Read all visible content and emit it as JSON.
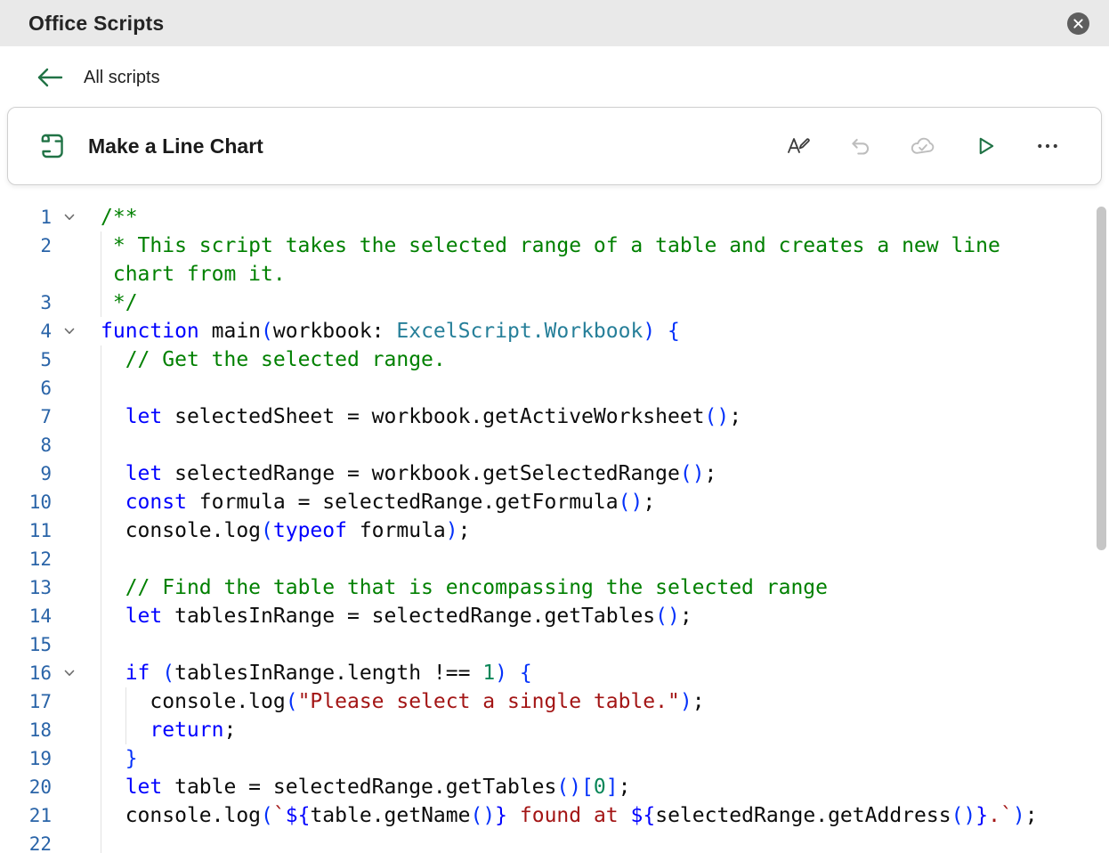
{
  "header": {
    "title": "Office Scripts"
  },
  "nav": {
    "back_label": "All scripts"
  },
  "card": {
    "title": "Make a Line Chart",
    "toolbar": [
      {
        "icon": "rename-icon",
        "enabled": true
      },
      {
        "icon": "undo-icon",
        "enabled": false
      },
      {
        "icon": "cloud-saved-icon",
        "enabled": false
      },
      {
        "icon": "run-icon",
        "enabled": true
      },
      {
        "icon": "ellipsis-icon",
        "enabled": true
      }
    ]
  },
  "colors": {
    "accent_green": "#217346",
    "close_bg": "#5e5e5e",
    "icon_dark": "#3b3b3b",
    "disabled_icon": "#bdbdbd",
    "line_number": "#2a64a8",
    "scrollbar": "#c6c6c6",
    "tokens": {
      "c": "#008000",
      "k": "#0000ff",
      "t": "#267f99",
      "s": "#a31515",
      "n": "#098658",
      "b": "#0431fa",
      "p": "#0b0b0b"
    }
  },
  "editor": {
    "lines": [
      {
        "num": 1,
        "fold": true,
        "guides": [],
        "rows": [
          [
            [
              "c",
              "/**"
            ]
          ]
        ]
      },
      {
        "num": 2,
        "fold": false,
        "guides": [
          0
        ],
        "rows": [
          [
            [
              "c",
              " * This script takes the selected range of a table and creates a new line"
            ]
          ],
          [
            [
              "c",
              " chart from it."
            ]
          ]
        ]
      },
      {
        "num": 3,
        "fold": false,
        "guides": [
          0
        ],
        "rows": [
          [
            [
              "c",
              " */"
            ]
          ]
        ]
      },
      {
        "num": 4,
        "fold": true,
        "guides": [],
        "rows": [
          [
            [
              "k",
              "function"
            ],
            [
              "p",
              " main"
            ],
            [
              "b",
              "("
            ],
            [
              "p",
              "workbook"
            ],
            [
              "p",
              ": "
            ],
            [
              "t",
              "ExcelScript.Workbook"
            ],
            [
              "b",
              ")"
            ],
            [
              "p",
              " "
            ],
            [
              "b",
              "{"
            ]
          ]
        ]
      },
      {
        "num": 5,
        "fold": false,
        "guides": [
          0
        ],
        "rows": [
          [
            [
              "p",
              "  "
            ],
            [
              "c",
              "// Get the selected range."
            ]
          ]
        ]
      },
      {
        "num": 6,
        "fold": false,
        "guides": [
          0
        ],
        "rows": [
          []
        ]
      },
      {
        "num": 7,
        "fold": false,
        "guides": [
          0
        ],
        "rows": [
          [
            [
              "p",
              "  "
            ],
            [
              "k",
              "let"
            ],
            [
              "p",
              " selectedSheet = workbook.getActiveWorksheet"
            ],
            [
              "b",
              "()"
            ],
            [
              "p",
              ";"
            ]
          ]
        ]
      },
      {
        "num": 8,
        "fold": false,
        "guides": [
          0
        ],
        "rows": [
          []
        ]
      },
      {
        "num": 9,
        "fold": false,
        "guides": [
          0
        ],
        "rows": [
          [
            [
              "p",
              "  "
            ],
            [
              "k",
              "let"
            ],
            [
              "p",
              " selectedRange = workbook.getSelectedRange"
            ],
            [
              "b",
              "()"
            ],
            [
              "p",
              ";"
            ]
          ]
        ]
      },
      {
        "num": 10,
        "fold": false,
        "guides": [
          0
        ],
        "rows": [
          [
            [
              "p",
              "  "
            ],
            [
              "k",
              "const"
            ],
            [
              "p",
              " formula = selectedRange.getFormula"
            ],
            [
              "b",
              "()"
            ],
            [
              "p",
              ";"
            ]
          ]
        ]
      },
      {
        "num": 11,
        "fold": false,
        "guides": [
          0
        ],
        "rows": [
          [
            [
              "p",
              "  "
            ],
            [
              "p",
              "console.log"
            ],
            [
              "b",
              "("
            ],
            [
              "k",
              "typeof"
            ],
            [
              "p",
              " formula"
            ],
            [
              "b",
              ")"
            ],
            [
              "p",
              ";"
            ]
          ]
        ]
      },
      {
        "num": 12,
        "fold": false,
        "guides": [
          0
        ],
        "rows": [
          []
        ]
      },
      {
        "num": 13,
        "fold": false,
        "guides": [
          0
        ],
        "rows": [
          [
            [
              "p",
              "  "
            ],
            [
              "c",
              "// Find the table that is encompassing the selected range"
            ]
          ]
        ]
      },
      {
        "num": 14,
        "fold": false,
        "guides": [
          0
        ],
        "rows": [
          [
            [
              "p",
              "  "
            ],
            [
              "k",
              "let"
            ],
            [
              "p",
              " tablesInRange = selectedRange.getTables"
            ],
            [
              "b",
              "()"
            ],
            [
              "p",
              ";"
            ]
          ]
        ]
      },
      {
        "num": 15,
        "fold": false,
        "guides": [
          0
        ],
        "rows": [
          []
        ]
      },
      {
        "num": 16,
        "fold": true,
        "guides": [
          0
        ],
        "rows": [
          [
            [
              "p",
              "  "
            ],
            [
              "k",
              "if"
            ],
            [
              "p",
              " "
            ],
            [
              "b",
              "("
            ],
            [
              "p",
              "tablesInRange.length !== "
            ],
            [
              "n",
              "1"
            ],
            [
              "b",
              ")"
            ],
            [
              "p",
              " "
            ],
            [
              "b",
              "{"
            ]
          ]
        ]
      },
      {
        "num": 17,
        "fold": false,
        "guides": [
          0,
          2
        ],
        "rows": [
          [
            [
              "p",
              "    "
            ],
            [
              "p",
              "console.log"
            ],
            [
              "b",
              "("
            ],
            [
              "s",
              "\"Please select a single table.\""
            ],
            [
              "b",
              ")"
            ],
            [
              "p",
              ";"
            ]
          ]
        ]
      },
      {
        "num": 18,
        "fold": false,
        "guides": [
          0,
          2
        ],
        "rows": [
          [
            [
              "p",
              "    "
            ],
            [
              "k",
              "return"
            ],
            [
              "p",
              ";"
            ]
          ]
        ]
      },
      {
        "num": 19,
        "fold": false,
        "guides": [
          0
        ],
        "rows": [
          [
            [
              "p",
              "  "
            ],
            [
              "b",
              "}"
            ]
          ]
        ]
      },
      {
        "num": 20,
        "fold": false,
        "guides": [
          0
        ],
        "rows": [
          [
            [
              "p",
              "  "
            ],
            [
              "k",
              "let"
            ],
            [
              "p",
              " table = selectedRange.getTables"
            ],
            [
              "b",
              "()["
            ],
            [
              "n",
              "0"
            ],
            [
              "b",
              "]"
            ],
            [
              "p",
              ";"
            ]
          ]
        ]
      },
      {
        "num": 21,
        "fold": false,
        "guides": [
          0
        ],
        "rows": [
          [
            [
              "p",
              "  "
            ],
            [
              "p",
              "console.log"
            ],
            [
              "b",
              "("
            ],
            [
              "s",
              "`"
            ],
            [
              "k",
              "${"
            ],
            [
              "p",
              "table.getName"
            ],
            [
              "b",
              "()"
            ],
            [
              "k",
              "}"
            ],
            [
              "s",
              " found at "
            ],
            [
              "k",
              "${"
            ],
            [
              "p",
              "selectedRange.getAddress"
            ],
            [
              "b",
              "()"
            ],
            [
              "k",
              "}"
            ],
            [
              "s",
              ".`"
            ],
            [
              "b",
              ")"
            ],
            [
              "p",
              ";"
            ]
          ]
        ]
      },
      {
        "num": 22,
        "fold": false,
        "guides": [
          0
        ],
        "rows": [
          []
        ]
      }
    ]
  }
}
